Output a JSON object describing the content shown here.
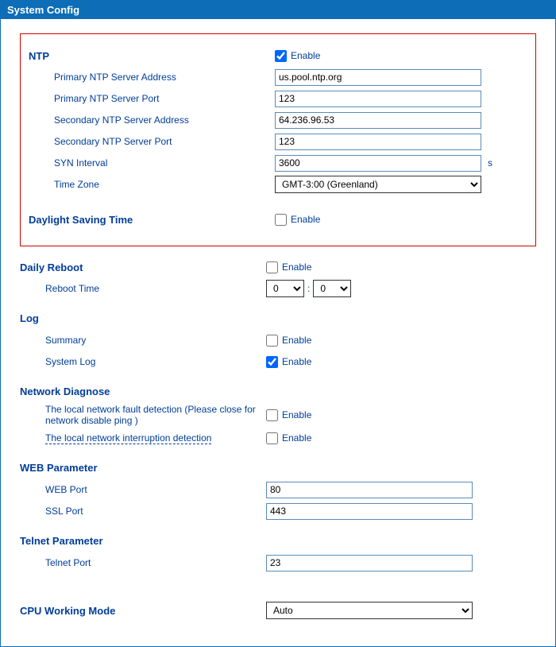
{
  "window": {
    "title": "System Config"
  },
  "ntp": {
    "heading": "NTP",
    "enable_label": "Enable",
    "enable_checked": true,
    "primary_addr_label": "Primary NTP Server Address",
    "primary_addr_value": "us.pool.ntp.org",
    "primary_port_label": "Primary NTP Server Port",
    "primary_port_value": "123",
    "secondary_addr_label": "Secondary NTP Server Address",
    "secondary_addr_value": "64.236.96.53",
    "secondary_port_label": "Secondary NTP Server Port",
    "secondary_port_value": "123",
    "syn_label": "SYN Interval",
    "syn_value": "3600",
    "syn_suffix": "s",
    "tz_label": "Time Zone",
    "tz_value": "GMT-3:00 (Greenland)"
  },
  "dst": {
    "heading": "Daylight Saving Time",
    "enable_label": "Enable",
    "enable_checked": false
  },
  "reboot": {
    "heading": "Daily Reboot",
    "enable_label": "Enable",
    "enable_checked": false,
    "time_label": "Reboot Time",
    "hour": "0",
    "colon": ":",
    "minute": "0"
  },
  "log": {
    "heading": "Log",
    "summary_label": "Summary",
    "summary_enable": "Enable",
    "summary_checked": false,
    "system_label": "System Log",
    "system_enable": "Enable",
    "system_checked": true
  },
  "diag": {
    "heading": "Network Diagnose",
    "fault_label": "The local network fault detection (Please close for network disable ping )",
    "fault_enable": "Enable",
    "fault_checked": false,
    "interrupt_label": "The local network interruption detection",
    "interrupt_enable": "Enable",
    "interrupt_checked": false
  },
  "web": {
    "heading": "WEB Parameter",
    "web_port_label": "WEB Port",
    "web_port_value": "80",
    "ssl_port_label": "SSL Port",
    "ssl_port_value": "443"
  },
  "telnet": {
    "heading": "Telnet Parameter",
    "port_label": "Telnet Port",
    "port_value": "23"
  },
  "cpu": {
    "heading": "CPU Working Mode",
    "value": "Auto"
  }
}
